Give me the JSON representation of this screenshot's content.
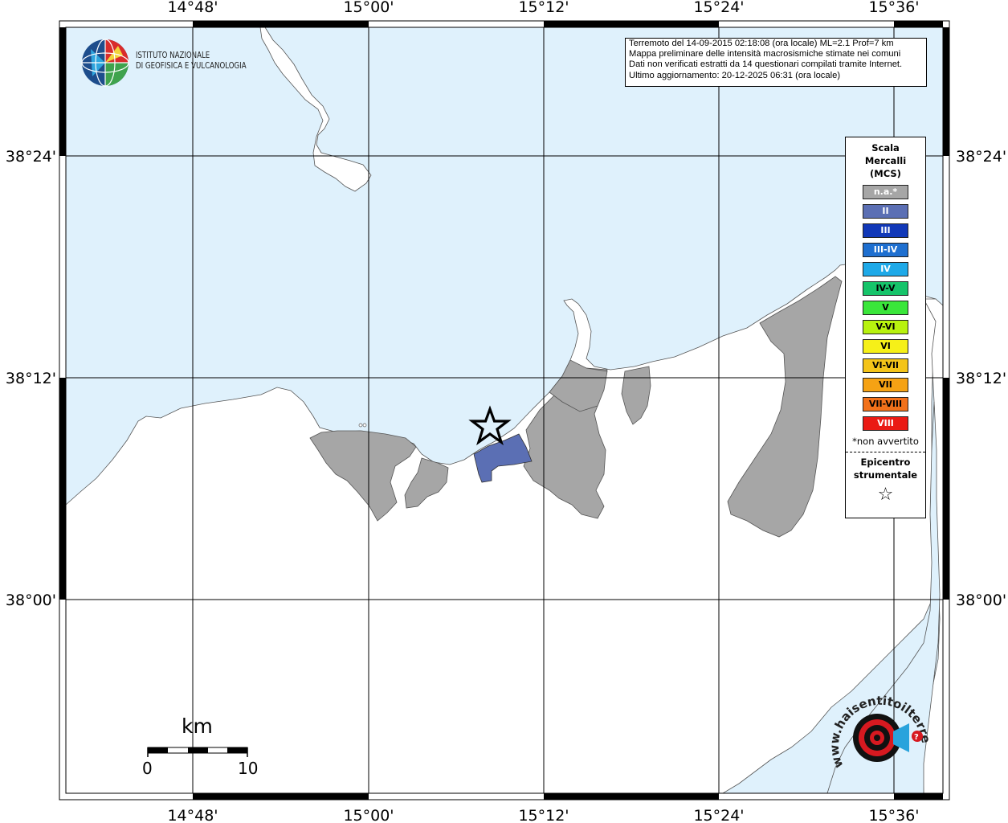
{
  "map": {
    "lon_ticks": [
      "14°48'",
      "15°00'",
      "15°12'",
      "15°24'",
      "15°36'"
    ],
    "lat_ticks": [
      "38°24'",
      "38°12'",
      "38°00'"
    ],
    "colors": {
      "sea": "#dff1fc",
      "land": "#ffffff",
      "not_felt": "#a6a6a6",
      "intensity_II": "#5b6fb4",
      "grid": "#000000"
    },
    "epicenter_label": "epicenter-star"
  },
  "info": {
    "line1": "Terremoto del 14-09-2015 02:18:08 (ora locale) ML=2.1 Prof=7 km",
    "line2": "Mappa preliminare delle intensità macrosismiche stimate nei comuni",
    "line3": "Dati non verificati estratti da 14 questionari compilati tramite Internet.",
    "line4": "Ultimo aggiornamento: 20-12-2025 06:31 (ora locale)"
  },
  "logo": {
    "line1": "ISTITUTO NAZIONALE",
    "line2": "DI GEOFISICA E VULCANOLOGIA"
  },
  "legend": {
    "title1": "Scala",
    "title2": "Mercalli",
    "title3": "(MCS)",
    "classes": [
      {
        "label": "n.a.*",
        "color": "#a6a6a6",
        "text_color": "#ffffff"
      },
      {
        "label": "II",
        "color": "#5b6fb4",
        "text_color": "#ffffff"
      },
      {
        "label": "III",
        "color": "#1138b8",
        "text_color": "#ffffff"
      },
      {
        "label": "III-IV",
        "color": "#1e6fd0",
        "text_color": "#ffffff"
      },
      {
        "label": "IV",
        "color": "#1ea9e8",
        "text_color": "#ffffff"
      },
      {
        "label": "IV-V",
        "color": "#16c46a",
        "text_color": "#000000"
      },
      {
        "label": "V",
        "color": "#3ae63a",
        "text_color": "#000000"
      },
      {
        "label": "V-VI",
        "color": "#b8f20f",
        "text_color": "#000000"
      },
      {
        "label": "VI",
        "color": "#f6f018",
        "text_color": "#000000"
      },
      {
        "label": "VI-VII",
        "color": "#f4c419",
        "text_color": "#000000"
      },
      {
        "label": "VII",
        "color": "#f5a214",
        "text_color": "#000000"
      },
      {
        "label": "VII-VIII",
        "color": "#f2711a",
        "text_color": "#000000"
      },
      {
        "label": "VIII",
        "color": "#ea1a14",
        "text_color": "#ffffff"
      }
    ],
    "note": "*non avvertito",
    "epi1": "Epicentro",
    "epi2": "strumentale",
    "epi_symbol": "☆"
  },
  "scale_bar": {
    "unit": "km",
    "start": "0",
    "end": "10"
  },
  "brand": {
    "text": "www.haisentitoilterremoto.it",
    "icon": "target-megaphone-icon"
  }
}
